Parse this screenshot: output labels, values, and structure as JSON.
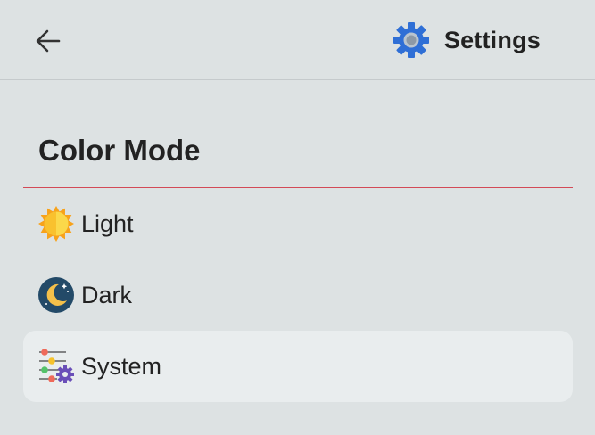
{
  "header": {
    "back_icon": "arrow-left-icon",
    "title_icon": "gear-icon",
    "title": "Settings",
    "accent_color": "#2f6fd6"
  },
  "section": {
    "title": "Color Mode",
    "divider_color": "#d34a57"
  },
  "options": [
    {
      "label": "Light",
      "icon": "sun-icon",
      "selected": false
    },
    {
      "label": "Dark",
      "icon": "moon-icon",
      "selected": false
    },
    {
      "label": "System",
      "icon": "system-settings-icon",
      "selected": true
    }
  ]
}
